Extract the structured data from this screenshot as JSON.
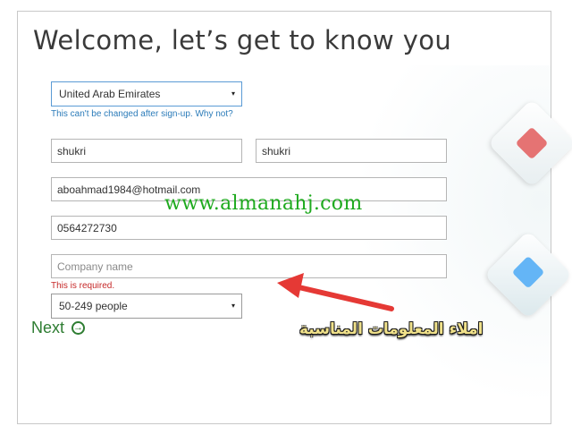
{
  "form": {
    "title": "Welcome, let’s get to know you",
    "country": {
      "value": "United Arab Emirates",
      "hint": "This can't be changed after sign-up. Why not?"
    },
    "first_name": "shukri",
    "last_name": "shukri",
    "email": "aboahmad1984@hotmail.com",
    "phone": "0564272730",
    "company": {
      "placeholder": "Company name",
      "error": "This is required."
    },
    "company_size": "50-249 people",
    "next_label": "Next"
  },
  "overlay": {
    "watermark": "www.almanahj.com",
    "arabic_caption": "املاء المعلومات المناسبة"
  },
  "icons": {
    "dropdown_caret": "▾",
    "next_arrow": "→"
  },
  "colors": {
    "accent_blue": "#2b7bb9",
    "next_green": "#2e7d32",
    "error_red": "#c62828",
    "watermark_green": "#1faa1f",
    "arrow_red": "#e53935"
  }
}
